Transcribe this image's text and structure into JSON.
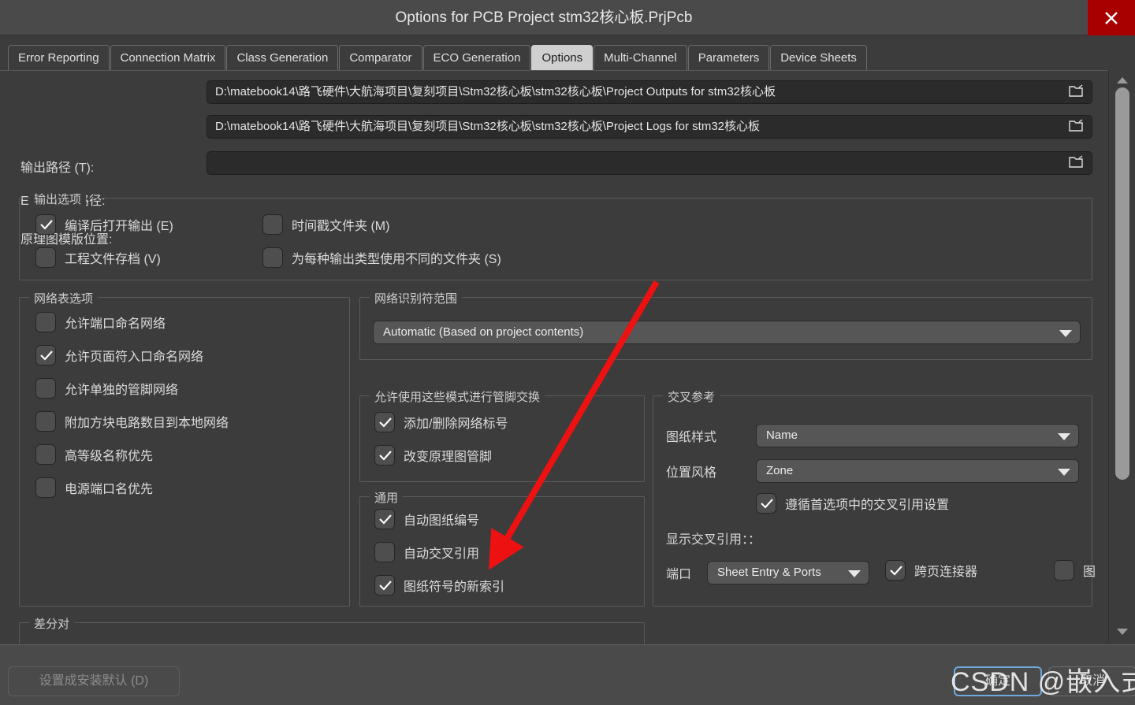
{
  "window": {
    "title": "Options for PCB Project stm32核心板.PrjPcb",
    "close_label": "close-icon",
    "close_color": "#a80000"
  },
  "tabs": [
    {
      "label": "Error Reporting",
      "active": false
    },
    {
      "label": "Connection Matrix",
      "active": false
    },
    {
      "label": "Class Generation",
      "active": false
    },
    {
      "label": "Comparator",
      "active": false
    },
    {
      "label": "ECO Generation",
      "active": false
    },
    {
      "label": "Options",
      "active": true
    },
    {
      "label": "Multi-Channel",
      "active": false
    },
    {
      "label": "Parameters",
      "active": false
    },
    {
      "label": "Device Sheets",
      "active": false
    }
  ],
  "paths": {
    "output_label": "输出路径 (T):",
    "output_value": "D:\\matebook14\\路飞硬件\\大航海项目\\复刻项目\\Stm32核心板\\stm32核心板\\Project Outputs for stm32核心板",
    "eco_label": "ECO 日志路径:",
    "eco_value": "D:\\matebook14\\路飞硬件\\大航海项目\\复刻项目\\Stm32核心板\\stm32核心板\\Project Logs for stm32核心板",
    "template_label": "原理图模版位置:",
    "template_value": ""
  },
  "output_options": {
    "title": "输出选项",
    "items": [
      {
        "label": "编译后打开输出 (E)",
        "checked": true
      },
      {
        "label": "时间戳文件夹 (M)",
        "checked": false
      },
      {
        "label": "工程文件存档 (V)",
        "checked": false
      },
      {
        "label": "为每种输出类型使用不同的文件夹 (S)",
        "checked": false
      }
    ]
  },
  "netlist_options": {
    "title": "网络表选项",
    "items": [
      {
        "label": "允许端口命名网络",
        "checked": false
      },
      {
        "label": "允许页面符入口命名网络",
        "checked": true
      },
      {
        "label": "允许单独的管脚网络",
        "checked": false
      },
      {
        "label": "附加方块电路数目到本地网络",
        "checked": false
      },
      {
        "label": "高等级名称优先",
        "checked": false
      },
      {
        "label": "电源端口名优先",
        "checked": false
      }
    ]
  },
  "net_identifier_scope": {
    "title": "网络识别符范围",
    "value": "Automatic (Based on project contents)"
  },
  "pin_swap": {
    "title": "允许使用这些模式进行管脚交换",
    "items": [
      {
        "label": "添加/删除网络标号",
        "checked": true
      },
      {
        "label": "改变原理图管脚",
        "checked": true
      }
    ]
  },
  "general": {
    "title": "通用",
    "items": [
      {
        "label": "自动图纸编号",
        "checked": true
      },
      {
        "label": "自动交叉引用",
        "checked": false
      },
      {
        "label": "图纸符号的新索引",
        "checked": true
      }
    ]
  },
  "cross_reference": {
    "title": "交叉参考",
    "sheet_style_label": "图纸样式",
    "sheet_style_value": "Name",
    "location_style_label": "位置风格",
    "location_style_value": "Zone",
    "follow_prefs": {
      "label": "遵循首选项中的交叉引用设置",
      "checked": true
    },
    "display_label": "显示交叉引用：：",
    "port_label": "端口",
    "port_value": "Sheet Entry & Ports",
    "offsheet": {
      "label": "跨页连接器",
      "checked": true
    },
    "clipped": {
      "label": "图",
      "checked": false
    }
  },
  "differential_pairs": {
    "title": "差分对"
  },
  "footer": {
    "defaults_label": "设置成安装默认 (D)",
    "ok_label": "确定",
    "cancel_label": "取消"
  },
  "annotation": {
    "watermark": "CSDN @嵌入式.LOG",
    "arrow_color": "#ee1111"
  }
}
